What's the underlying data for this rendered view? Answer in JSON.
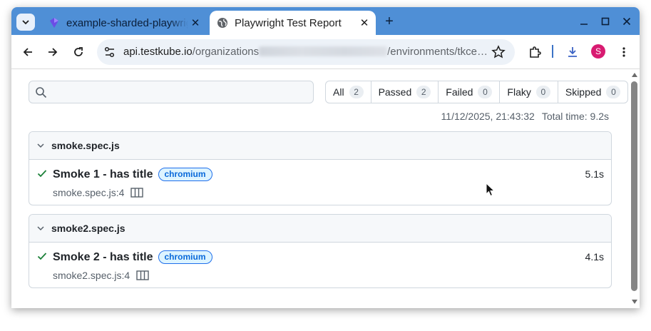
{
  "browser": {
    "tabs": [
      {
        "label": "example-sharded-playwright",
        "active": false,
        "icon": "testkube-logo-icon"
      },
      {
        "label": "Playwright Test Report",
        "active": true,
        "icon": "globe-icon"
      }
    ],
    "new_tab_label": "+",
    "close_glyph": "✕",
    "url_host": "api.testkube.io",
    "url_path_1": "/organizations",
    "url_path_2": "/environments/tkce…",
    "profile_initial": "S"
  },
  "report": {
    "search_placeholder": "",
    "filters": [
      {
        "label": "All",
        "count": "2"
      },
      {
        "label": "Passed",
        "count": "2"
      },
      {
        "label": "Failed",
        "count": "0"
      },
      {
        "label": "Flaky",
        "count": "0"
      },
      {
        "label": "Skipped",
        "count": "0"
      }
    ],
    "timestamp": "11/12/2025, 21:43:32",
    "total_time": "Total time: 9.2s",
    "files": [
      {
        "name": "smoke.spec.js",
        "test": {
          "title": "Smoke 1 - has title",
          "project": "chromium",
          "location": "smoke.spec.js:4",
          "duration": "5.1s",
          "status": "passed"
        }
      },
      {
        "name": "smoke2.spec.js",
        "test": {
          "title": "Smoke 2 - has title",
          "project": "chromium",
          "location": "smoke2.spec.js:4",
          "duration": "4.1s",
          "status": "passed"
        }
      }
    ]
  },
  "colors": {
    "tabstrip": "#4f8fd6",
    "passed": "#1a7f37",
    "badge": "#0969da"
  }
}
